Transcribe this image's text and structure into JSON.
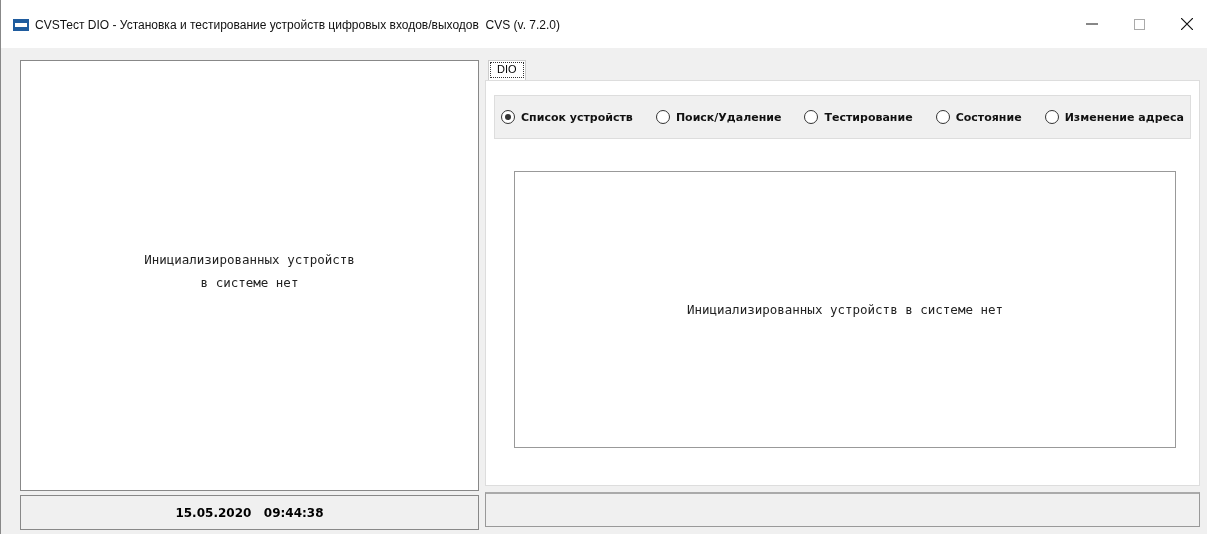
{
  "window": {
    "title": "CVSТест DIO - Установка и тестирование устройств цифровых входов/выходов  CVS (v. 7.2.0)"
  },
  "left_panel": {
    "message_lines": [
      "Инициализированных устройств",
      "в системе нет"
    ]
  },
  "tabs": [
    {
      "label": "DIO",
      "selected": true
    }
  ],
  "modes": [
    {
      "label": "Список устройств",
      "selected": true
    },
    {
      "label": "Поиск/Удаление",
      "selected": false
    },
    {
      "label": "Тестирование",
      "selected": false
    },
    {
      "label": "Состояние",
      "selected": false
    },
    {
      "label": "Изменение адреса",
      "selected": false
    }
  ],
  "device_list": {
    "message": "Инициализированных устройств в системе нет"
  },
  "status_bar": {
    "datetime": "15.05.2020   09:44:38"
  }
}
